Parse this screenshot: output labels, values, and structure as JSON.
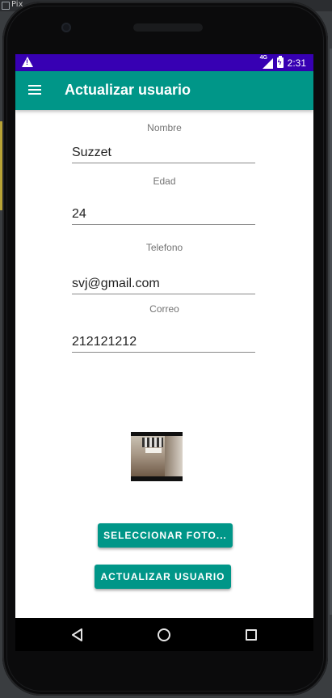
{
  "emulator": {
    "window_title": "Pix"
  },
  "status_bar": {
    "network_label": "4G",
    "time": "2:31",
    "alert_icon": "warning-icon",
    "signal_icon": "cellular-signal-icon",
    "battery_icon": "battery-charging-icon",
    "battery_mark": "ϟ",
    "color": "#3700b3"
  },
  "app_bar": {
    "title": "Actualizar usuario",
    "menu_icon": "hamburger-menu-icon",
    "color": "#009688"
  },
  "form": {
    "fields": [
      {
        "label": "Nombre",
        "value": "Suzzet"
      },
      {
        "label": "Edad",
        "value": "24"
      },
      {
        "label": "Telefono",
        "value": "svj@gmail.com"
      },
      {
        "label": "Correo",
        "value": "212121212"
      }
    ]
  },
  "photo": {
    "name": "user-photo-thumbnail"
  },
  "buttons": {
    "select_photo": "SELECCIONAR FOTO...",
    "update_user": "ACTUALIZAR USUARIO"
  },
  "nav_bar": {
    "back_icon": "back-triangle-icon",
    "home_icon": "home-circle-icon",
    "recents_icon": "recents-square-icon"
  }
}
